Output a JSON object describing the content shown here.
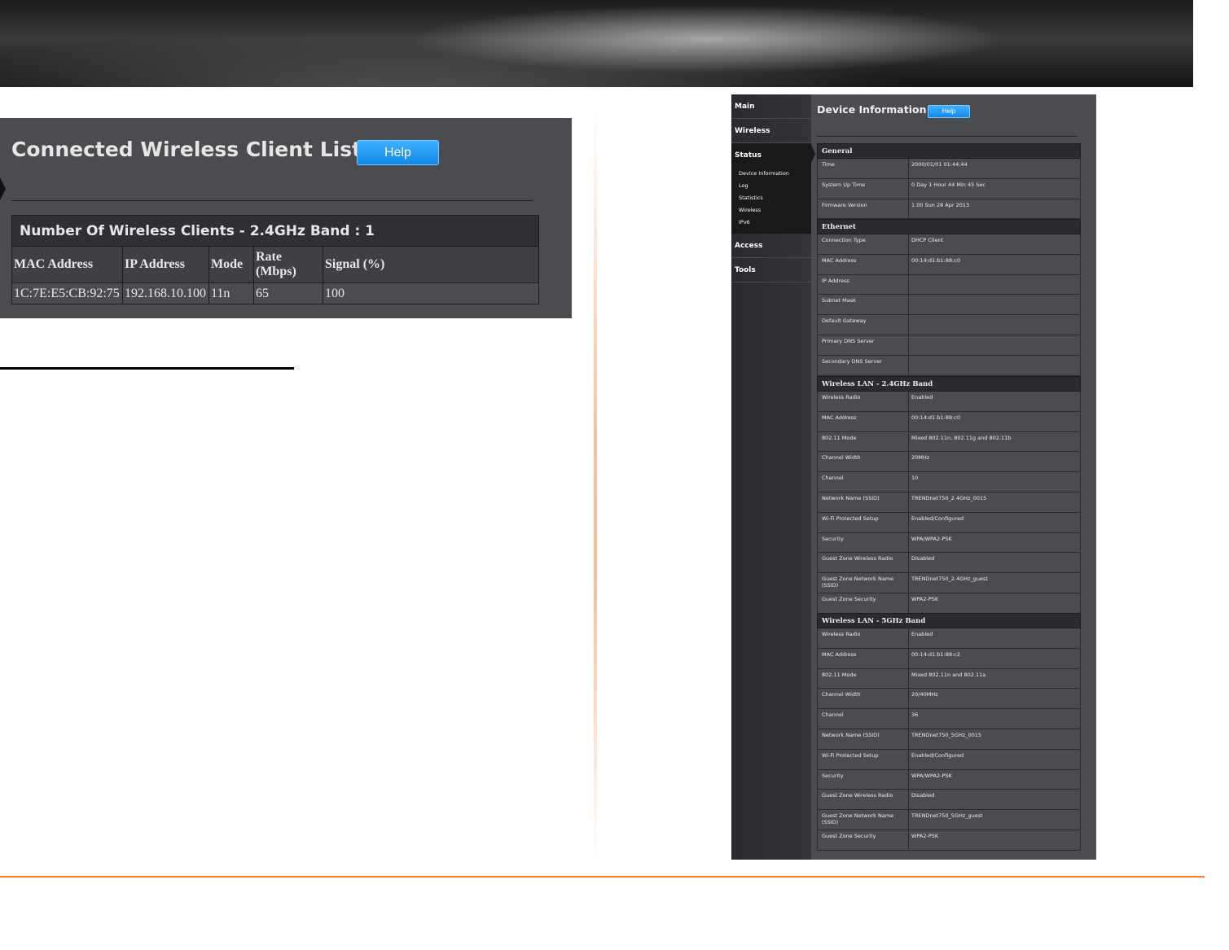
{
  "client_list": {
    "title": "Connected Wireless Client List",
    "help_label": "Help",
    "band_header": "Number Of Wireless Clients - 2.4GHz Band : 1",
    "columns": [
      "MAC Address",
      "IP Address",
      "Mode",
      "Rate (Mbps)",
      "Signal (%)"
    ],
    "rows": [
      [
        "1C:7E:E5:CB:92:75",
        "192.168.10.100",
        "11n",
        "65",
        "100"
      ]
    ]
  },
  "device_info": {
    "title": "Device Information",
    "help_label": "Help",
    "nav": {
      "main": "Main",
      "wireless": "Wireless",
      "status": "Status",
      "access": "Access",
      "tools": "Tools",
      "status_sub": [
        "Device Information",
        "Log",
        "Statistics",
        "Wireless",
        "IPv6"
      ]
    },
    "sections": [
      {
        "heading": "General",
        "rows": [
          [
            "Time",
            "2000/01/01 01:44:44"
          ],
          [
            "System Up Time",
            "0 Day 1 Hour 44 Min 45 Sec"
          ],
          [
            "Firmware Version",
            "1.00 Sun 28 Apr 2013"
          ]
        ]
      },
      {
        "heading": "Ethernet",
        "rows": [
          [
            "Connection Type",
            "DHCP Client"
          ],
          [
            "MAC Address",
            "00:14:d1:b1:88:c0"
          ],
          [
            "IP Address",
            ""
          ],
          [
            "Subnet Mask",
            ""
          ],
          [
            "Default Gateway",
            ""
          ],
          [
            "Primary DNS Server",
            ""
          ],
          [
            "Secondary DNS Server",
            ""
          ]
        ]
      },
      {
        "heading": "Wireless LAN - 2.4GHz Band",
        "rows": [
          [
            "Wireless Radio",
            "Enabled"
          ],
          [
            "MAC Address",
            "00:14:d1:b1:88:c0"
          ],
          [
            "802.11 Mode",
            "Mixed 802.11n, 802.11g and 802.11b"
          ],
          [
            "Channel Width",
            "20MHz"
          ],
          [
            "Channel",
            "10"
          ],
          [
            "Network Name (SSID)",
            "TRENDnet750_2.4GHz_0015"
          ],
          [
            "Wi-Fi Protected Setup",
            "Enabled/Configured"
          ],
          [
            "Security",
            "WPA/WPA2-PSK"
          ],
          [
            "Guest Zone Wireless Radio",
            "Disabled"
          ],
          [
            "Guest Zone Network Name (SSID)",
            "TRENDnet750_2.4GHz_guest"
          ],
          [
            "Guest Zone Security",
            "WPA2-PSK"
          ]
        ]
      },
      {
        "heading": "Wireless LAN - 5GHz Band",
        "rows": [
          [
            "Wireless Radio",
            "Enabled"
          ],
          [
            "MAC Address",
            "00:14:d1:b1:88:c2"
          ],
          [
            "802.11 Mode",
            "Mixed 802.11n and 802.11a"
          ],
          [
            "Channel Width",
            "20/40MHz"
          ],
          [
            "Channel",
            "36"
          ],
          [
            "Network Name (SSID)",
            "TRENDnet750_5GHz_0015"
          ],
          [
            "Wi-Fi Protected Setup",
            "Enabled/Configured"
          ],
          [
            "Security",
            "WPA/WPA2-PSK"
          ],
          [
            "Guest Zone Wireless Radio",
            "Disabled"
          ],
          [
            "Guest Zone Network Name (SSID)",
            "TRENDnet750_5GHz_guest"
          ],
          [
            "Guest Zone Security",
            "WPA2-PSK"
          ]
        ]
      }
    ]
  }
}
